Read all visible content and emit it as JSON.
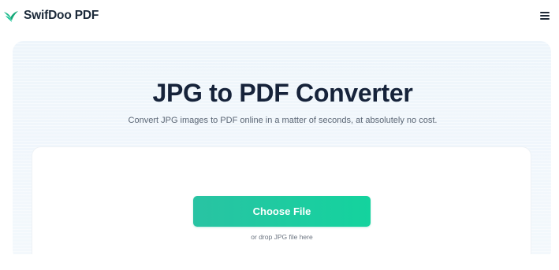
{
  "header": {
    "brand": "SwifDoo PDF",
    "logo_icon": "swift-bird-logo",
    "menu_icon": "hamburger-menu-icon"
  },
  "hero": {
    "title": "JPG to PDF Converter",
    "subtitle": "Convert JPG images to PDF online in a matter of seconds, at absolutely no cost."
  },
  "upload": {
    "button_label": "Choose File",
    "hint": "or drop JPG file here"
  },
  "colors": {
    "brand_green": "#17c99c",
    "title_dark": "#16233a",
    "hero_bg": "#eef5fb"
  }
}
